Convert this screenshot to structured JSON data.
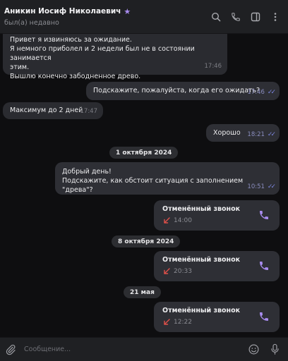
{
  "header": {
    "name": "Аникин Иосиф Николаевич",
    "status": "был(а) недавно",
    "icons": [
      "star-icon",
      "search-icon",
      "phone-icon",
      "sidebar-toggle-icon",
      "more-vert-icon"
    ]
  },
  "messages": [
    {
      "direction": "in",
      "lines": [
        "Привет я извиняюсь за ожидание.",
        "Я немного приболел и 2 недели был не в состоянии занимается",
        "этим.",
        "Вышлю конечно забодненное древо."
      ],
      "time": "17:46"
    },
    {
      "direction": "out",
      "text": "Подскажите, пожалуйста, когда его ожидать?",
      "time": "17:46",
      "read": true
    },
    {
      "direction": "in",
      "text": "Максимум до 2 дней",
      "time": "17:47"
    },
    {
      "direction": "out",
      "text": "Хорошо",
      "time": "18:21",
      "read": true
    },
    {
      "direction": "out",
      "lines": [
        "Добрый день!",
        "Подскажите, как обстоит ситуация с заполнением \"древа\"?"
      ],
      "time": "10:51",
      "read": true
    }
  ],
  "dates": [
    "1 октября 2024",
    "8 октября 2024",
    "21 мая"
  ],
  "calls": [
    {
      "title": "Отменённый звонок",
      "time": "14:00",
      "type": "missed-outgoing"
    },
    {
      "title": "Отменённый звонок",
      "time": "20:33",
      "type": "missed-outgoing"
    },
    {
      "title": "Отменённый звонок",
      "time": "12:22",
      "type": "missed-outgoing"
    }
  ],
  "composer": {
    "placeholder": "Сообщение..."
  },
  "colors": {
    "background": "#0e0e10",
    "header": "#1f2023",
    "bubble": "#2e2f35",
    "accent": "#a98cf0",
    "read_ticks": "#7c86e0",
    "missed_call": "#e0504a"
  }
}
